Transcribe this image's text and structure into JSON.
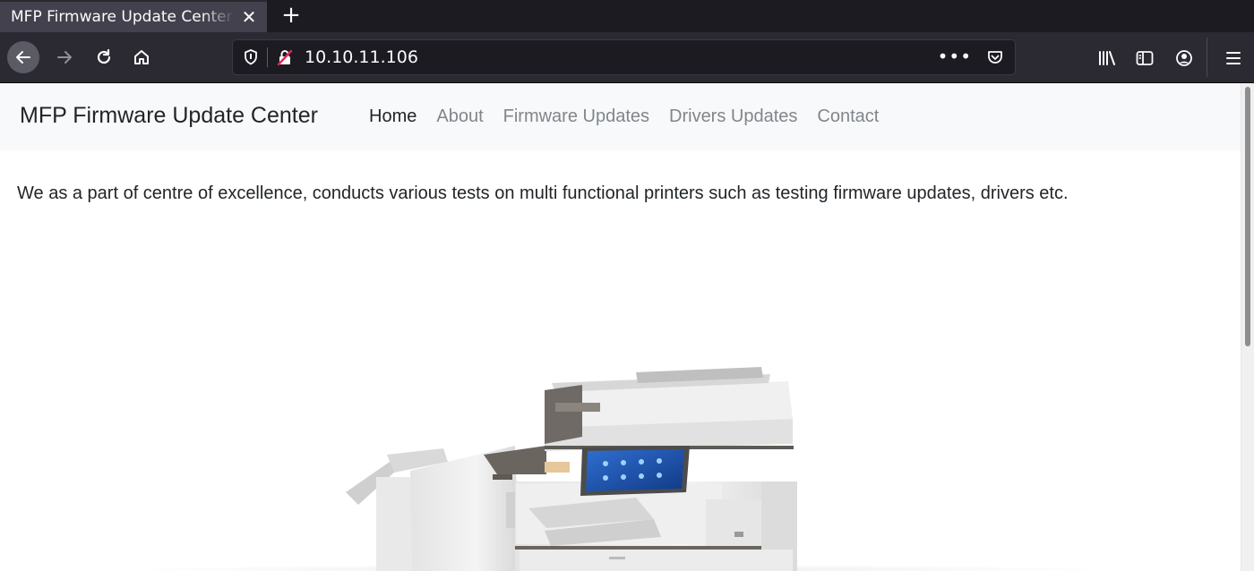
{
  "browser": {
    "tab_title": "MFP Firmware Update Center",
    "tab_close_icon": "close-icon",
    "new_tab_icon": "plus-icon",
    "url": "10.10.11.106",
    "page_actions": "•••",
    "icons": {
      "back": "arrow-left-icon",
      "forward": "arrow-right-icon",
      "reload": "reload-icon",
      "home": "home-icon",
      "shield": "shield-icon",
      "insecure": "insecure-lock-icon",
      "pocket": "pocket-icon",
      "library": "library-icon",
      "sidebar": "sidebar-icon",
      "account": "account-icon",
      "menu": "hamburger-menu-icon"
    }
  },
  "site": {
    "brand": "MFP Firmware Update Center",
    "nav": [
      {
        "label": "Home",
        "active": true
      },
      {
        "label": "About",
        "active": false
      },
      {
        "label": "Firmware Updates",
        "active": false
      },
      {
        "label": "Drivers Updates",
        "active": false
      },
      {
        "label": "Contact",
        "active": false
      }
    ],
    "intro": "We as a part of centre of excellence, conducts various tests on multi functional printers such as testing firmware updates, drivers etc.",
    "image_subject": "multifunction-printer-image"
  },
  "colors": {
    "chrome_dark": "#1c1b22",
    "chrome_toolbar": "#2b2a33",
    "tab_active": "#42414d",
    "navbar_bg": "#f8f9fa",
    "text_dark": "#212529",
    "text_muted": "#80868b"
  }
}
